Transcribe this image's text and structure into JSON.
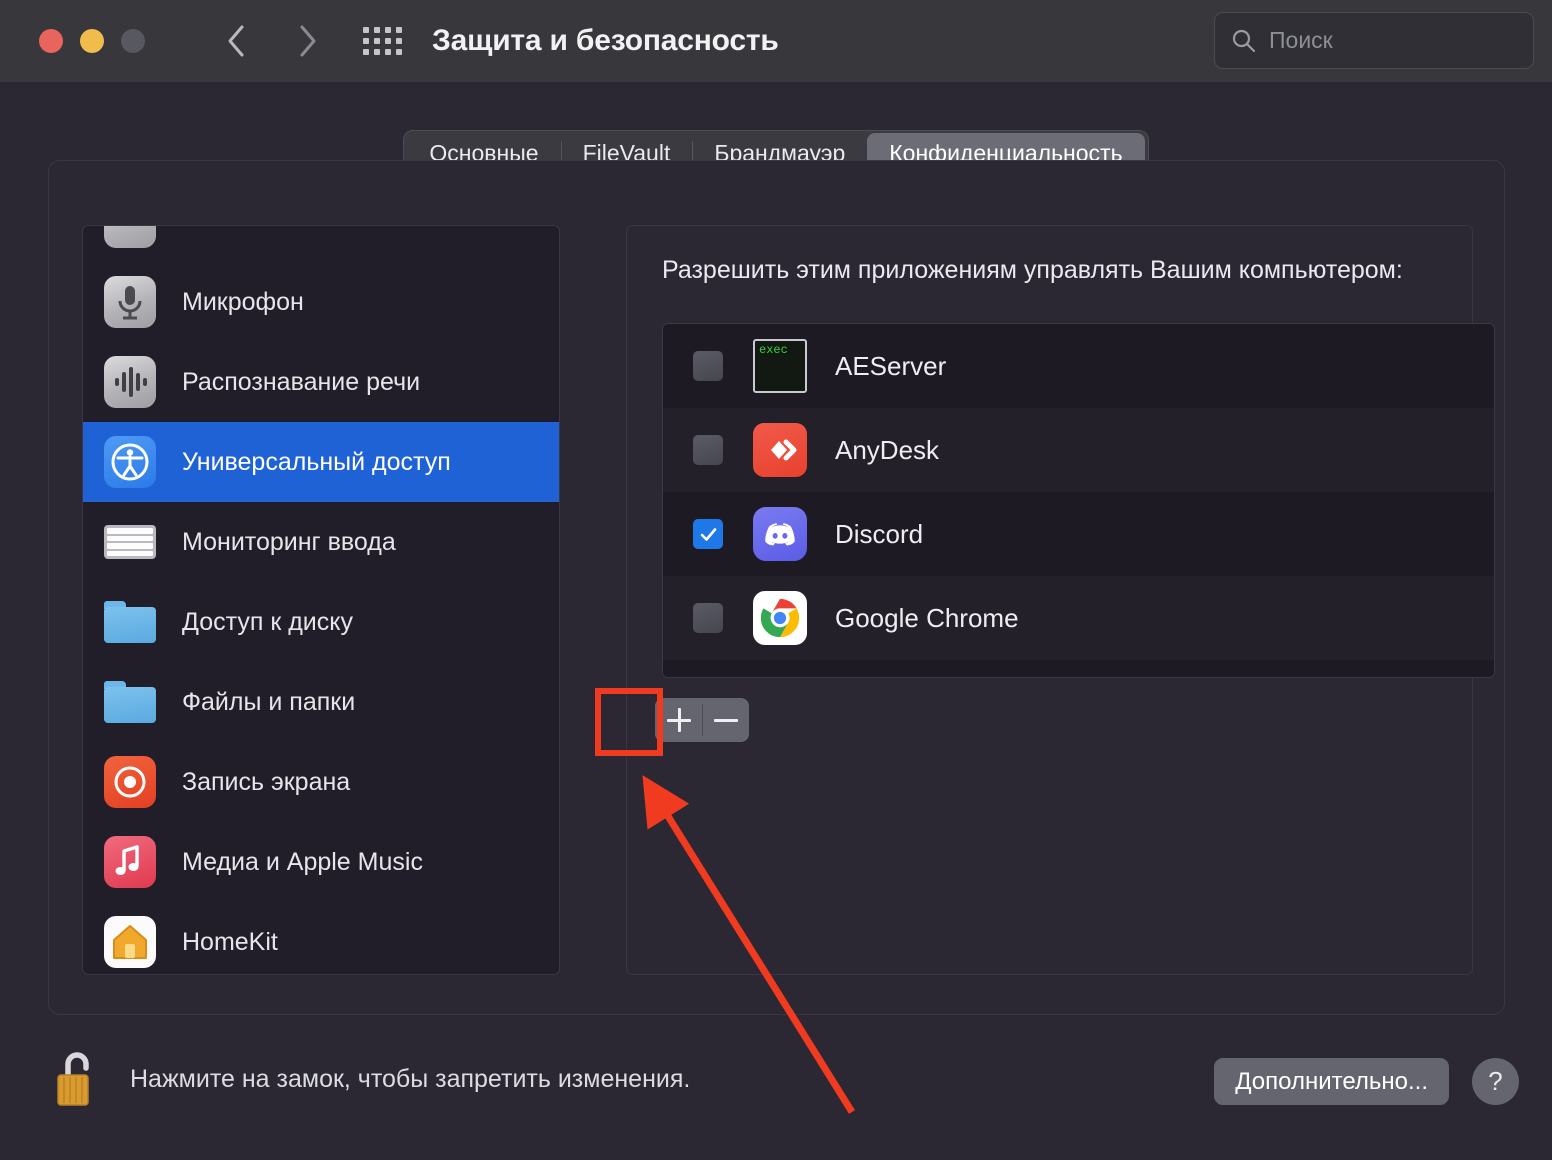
{
  "window": {
    "title": "Защита и безопасность",
    "traffic_lights": [
      "close",
      "minimize",
      "zoom"
    ],
    "back_label": "Назад",
    "forward_label": "Вперёд",
    "grid_label": "Показать все"
  },
  "search": {
    "placeholder": "Поиск",
    "value": ""
  },
  "tabs": [
    {
      "label": "Основные",
      "active": false
    },
    {
      "label": "FileVault",
      "active": false
    },
    {
      "label": "Брандмауэр",
      "active": false
    },
    {
      "label": "Конфиденциальность",
      "active": true
    }
  ],
  "sidebar": {
    "items": [
      {
        "label": "",
        "icon": "partial-grey-icon",
        "selected": false
      },
      {
        "label": "Микрофон",
        "icon": "microphone-icon",
        "selected": false
      },
      {
        "label": "Распознавание речи",
        "icon": "speech-recognition-icon",
        "selected": false
      },
      {
        "label": "Универсальный доступ",
        "icon": "accessibility-icon",
        "selected": true
      },
      {
        "label": "Мониторинг ввода",
        "icon": "keyboard-icon",
        "selected": false
      },
      {
        "label": "Доступ к диску",
        "icon": "folder-icon",
        "selected": false
      },
      {
        "label": "Файлы и папки",
        "icon": "folder-icon",
        "selected": false
      },
      {
        "label": "Запись экрана",
        "icon": "screen-recording-icon",
        "selected": false
      },
      {
        "label": "Медиа и Apple Music",
        "icon": "music-icon",
        "selected": false
      },
      {
        "label": "HomeKit",
        "icon": "homekit-icon",
        "selected": false
      }
    ]
  },
  "main": {
    "heading": "Разрешить этим приложениям управлять Вашим компьютером:",
    "apps": [
      {
        "name": "AEServer",
        "checked": false,
        "icon": "exec-terminal-icon"
      },
      {
        "name": "AnyDesk",
        "checked": false,
        "icon": "anydesk-icon"
      },
      {
        "name": "Discord",
        "checked": true,
        "icon": "discord-icon"
      },
      {
        "name": "Google Chrome",
        "checked": false,
        "icon": "chrome-icon"
      }
    ],
    "exec_icon_text": "exec",
    "add_button_label": "+",
    "remove_button_label": "−"
  },
  "footer": {
    "lock_text": "Нажмите на замок, чтобы запретить изменения.",
    "advanced_label": "Дополнительно...",
    "help_label": "?"
  },
  "annotation": {
    "highlight_target": "add-button",
    "color": "#f03b20"
  },
  "colors": {
    "window_bg": "#2b2733",
    "titlebar_bg": "#37373c",
    "accent_blue": "#1f62d6",
    "checkbox_on": "#1f78e8",
    "annotation_red": "#f03b20"
  }
}
